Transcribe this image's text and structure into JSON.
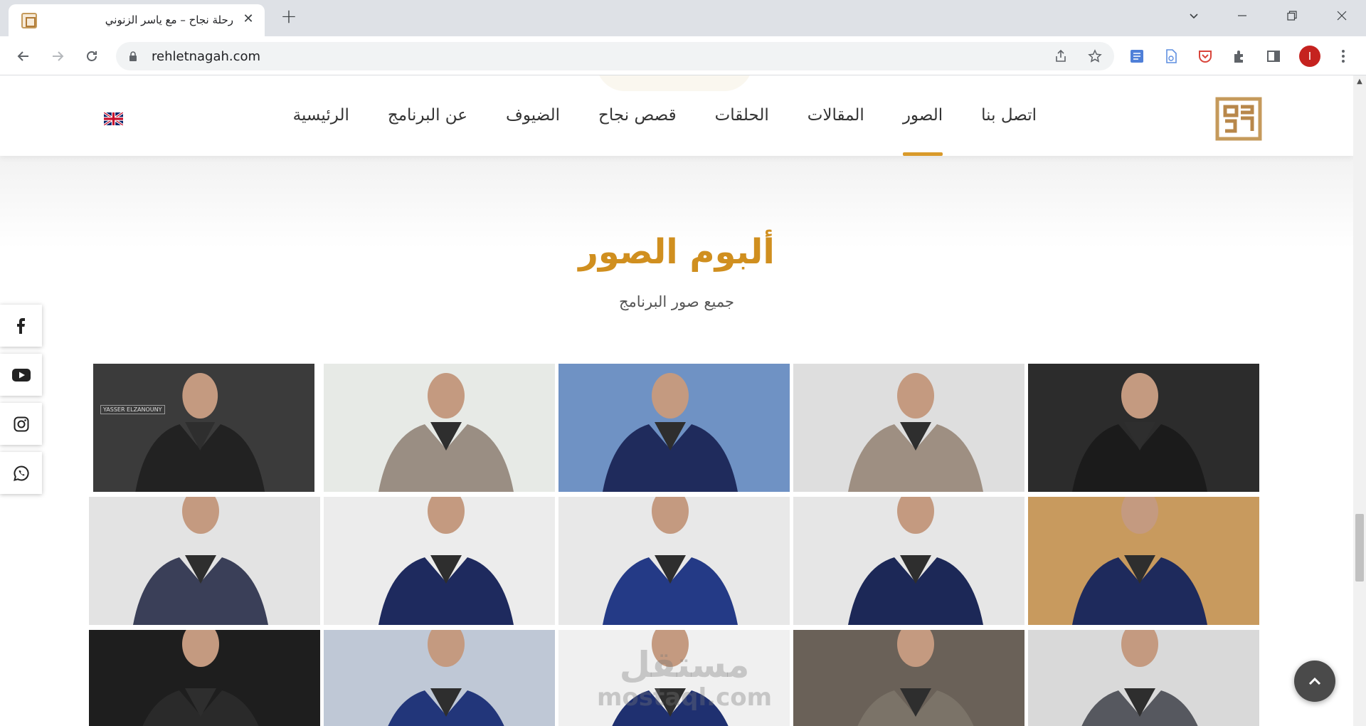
{
  "browser": {
    "tab_title": "رحلة نجاح – مع ياسر الزنوني",
    "tab_close": "✕",
    "new_tab": "+",
    "url": "rehletnagah.com",
    "avatar_letter": "I",
    "controls": {
      "minimize": "—",
      "restore": "❐",
      "close": "✕",
      "tab_search": "⌄"
    }
  },
  "nav": {
    "items": [
      {
        "label": "الرئيسية",
        "active": false
      },
      {
        "label": "عن البرنامج",
        "active": false
      },
      {
        "label": "الضيوف",
        "active": false
      },
      {
        "label": "قصص نجاح",
        "active": false
      },
      {
        "label": "الحلقات",
        "active": false
      },
      {
        "label": "المقالات",
        "active": false
      },
      {
        "label": "الصور",
        "active": true
      },
      {
        "label": "اتصل بنا",
        "active": false
      }
    ],
    "accent": "#d99a2b"
  },
  "section": {
    "title": "ألبوم الصور",
    "subtitle": "جميع صور البرنامج",
    "title_color": "#d08f1f"
  },
  "social": [
    "facebook-icon",
    "youtube-icon",
    "instagram-icon",
    "whatsapp-icon"
  ],
  "gallery": {
    "photos": [
      {
        "name": "portrait-dark-studio",
        "bg": "#3b3b3b",
        "suit": "#222222",
        "caption": "YASSER ELZANOUNY"
      },
      {
        "name": "portrait-grey-suit",
        "bg": "#e7eae6",
        "suit": "#9a8e83",
        "caption": ""
      },
      {
        "name": "portrait-navy-blue-bg",
        "bg": "#6f92c4",
        "suit": "#1f2b5c",
        "caption": ""
      },
      {
        "name": "portrait-grey-suit-watch",
        "bg": "#dedede",
        "suit": "#9e8f82",
        "caption": ""
      },
      {
        "name": "portrait-bw-hexagon",
        "bg": "#2c2c2c",
        "suit": "#1b1b1b",
        "caption": ""
      },
      {
        "name": "full-grey-vest",
        "bg": "#e3e3e3",
        "suit": "#3a3f58",
        "caption": ""
      },
      {
        "name": "full-navy-hand-pocket",
        "bg": "#ececec",
        "suit": "#1e2a5e",
        "caption": ""
      },
      {
        "name": "navy-suit-closeup",
        "bg": "#e8e8e8",
        "suit": "#243a86",
        "caption": ""
      },
      {
        "name": "full-navy-standing",
        "bg": "#e6e6e6",
        "suit": "#1c2857",
        "caption": ""
      },
      {
        "name": "full-navy-gold-bg",
        "bg": "#c89a5e",
        "suit": "#1e2a5c",
        "caption": ""
      },
      {
        "name": "portrait-bw-leather",
        "bg": "#1e1e1e",
        "suit": "#2a2a2a",
        "caption": ""
      },
      {
        "name": "navy-suit-blue-bg",
        "bg": "#bfc8d6",
        "suit": "#22367a",
        "caption": ""
      },
      {
        "name": "navy-suit-white-bg",
        "bg": "#f0f0f0",
        "suit": "#1f3070",
        "caption": ""
      },
      {
        "name": "portrait-sepia-grey",
        "bg": "#6a6158",
        "suit": "#7b7368",
        "caption": ""
      },
      {
        "name": "full-grey-suit",
        "bg": "#d9d9d9",
        "suit": "#56585f",
        "caption": ""
      }
    ]
  },
  "watermark": {
    "ar": "مستقل",
    "en": "mostaql.com"
  },
  "back_to_top": "⌃"
}
